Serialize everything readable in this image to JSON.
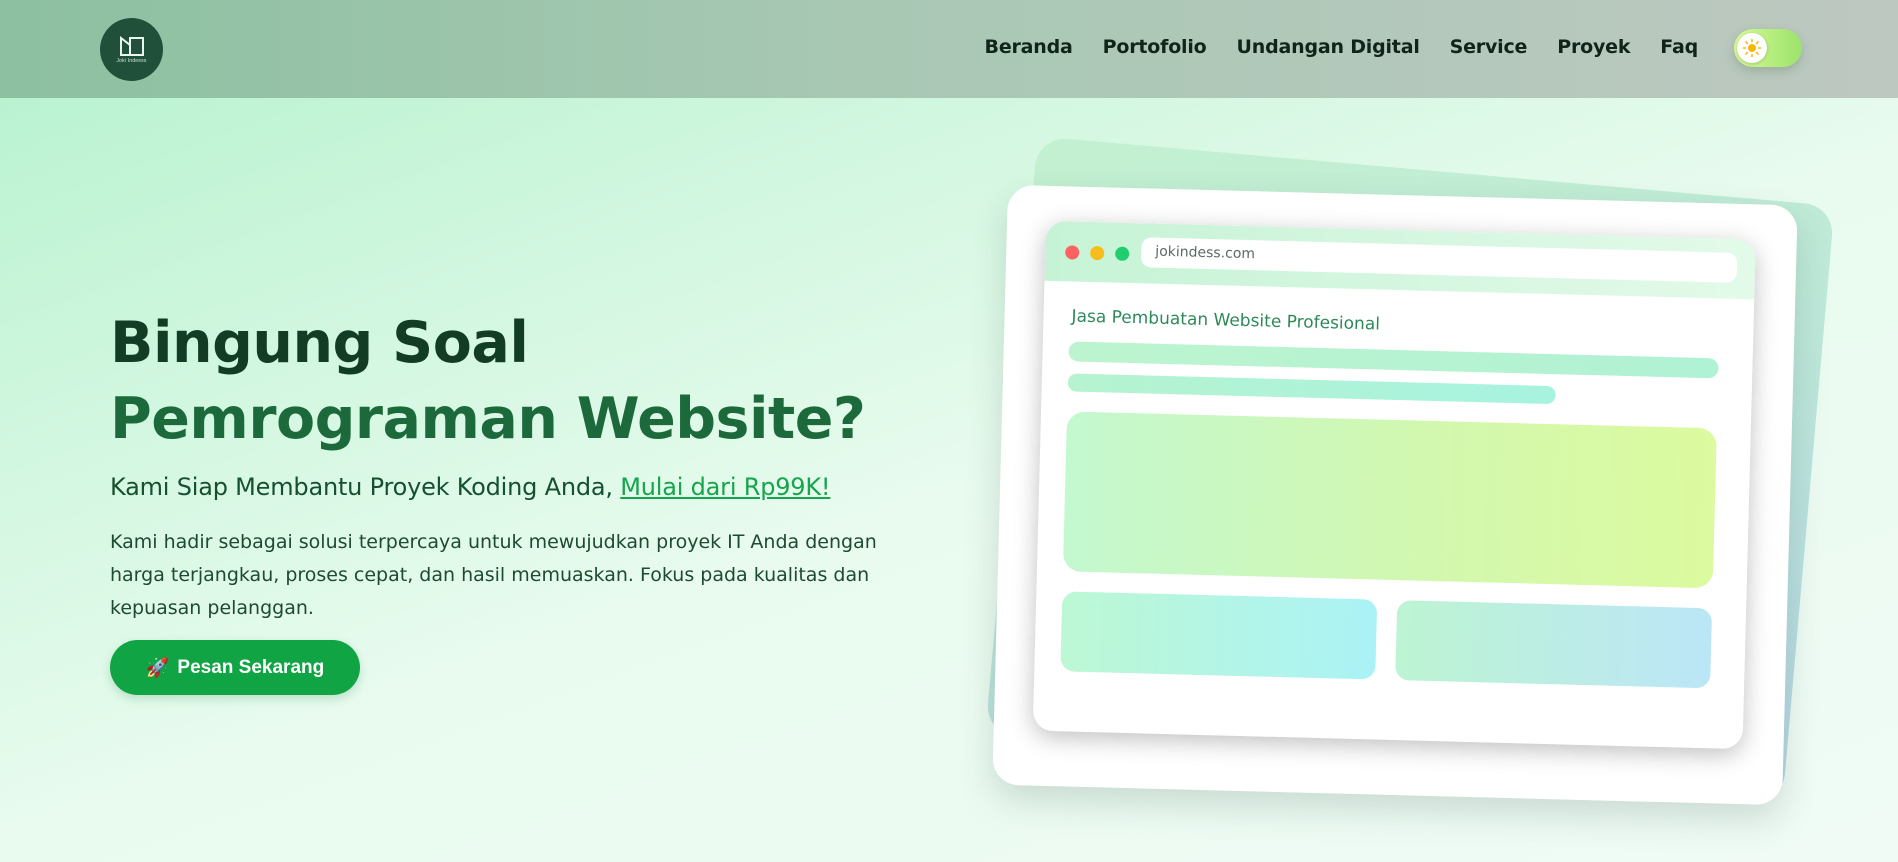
{
  "navbar": {
    "logo_text": "Joki Indeess",
    "links": [
      "Beranda",
      "Portofolio",
      "Undangan Digital",
      "Service",
      "Proyek",
      "Faq"
    ],
    "theme_toggle_icon": "sun-icon"
  },
  "hero": {
    "title_line1": "Bingung Soal",
    "title_line2": "Pemrograman Website?",
    "subtitle_prefix": "Kami Siap Membantu Proyek Koding Anda, ",
    "subtitle_link": "Mulai dari Rp99K!",
    "description": "Kami hadir sebagai solusi terpercaya untuk mewujudkan proyek IT Anda dengan harga terjangkau, proses cepat, dan hasil memuaskan. Fokus pada kualitas dan kepuasan pelanggan.",
    "cta_icon": "🚀",
    "cta_label": "Pesan Sekarang"
  },
  "mockup": {
    "url": "jokindess.com",
    "site_title": "Jasa Pembuatan Website Profesional"
  },
  "colors": {
    "brand_green": "#10a445",
    "title_dark": "#123c24",
    "title_green": "#1c6a3c",
    "logo_bg": "#20503a"
  }
}
